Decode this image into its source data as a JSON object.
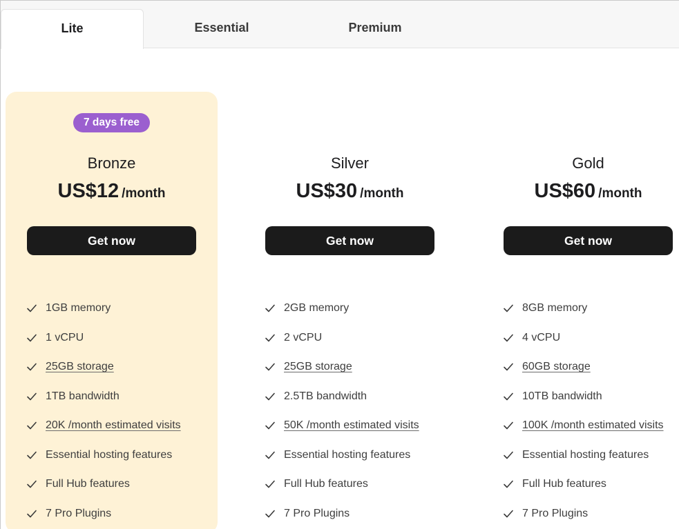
{
  "tabs": [
    {
      "label": "Lite",
      "active": true
    },
    {
      "label": "Essential",
      "active": false
    },
    {
      "label": "Premium",
      "active": false
    }
  ],
  "colors": {
    "highlight_bg": "#fef2d6",
    "badge_bg": "#9b5fcf",
    "button_bg": "#1b1b1b"
  },
  "plans": [
    {
      "badge": "7 days free",
      "name": "Bronze",
      "price": "US$12",
      "period": "/month",
      "cta": "Get now",
      "features": [
        "1GB memory",
        "1 vCPU",
        "25GB storage",
        "1TB bandwidth",
        "20K /month estimated visits",
        "Essential hosting features",
        "Full Hub features",
        "7 Pro Plugins"
      ]
    },
    {
      "name": "Silver",
      "price": "US$30",
      "period": "/month",
      "cta": "Get now",
      "features": [
        "2GB memory",
        "2 vCPU",
        "25GB storage",
        "2.5TB bandwidth",
        "50K /month estimated visits",
        "Essential hosting features",
        "Full Hub features",
        "7 Pro Plugins"
      ]
    },
    {
      "name": "Gold",
      "price": "US$60",
      "period": "/month",
      "cta": "Get now",
      "features": [
        "8GB memory",
        "4 vCPU",
        "60GB storage",
        "10TB bandwidth",
        "100K /month estimated visits",
        "Essential hosting features",
        "Full Hub features",
        "7 Pro Plugins"
      ]
    }
  ]
}
